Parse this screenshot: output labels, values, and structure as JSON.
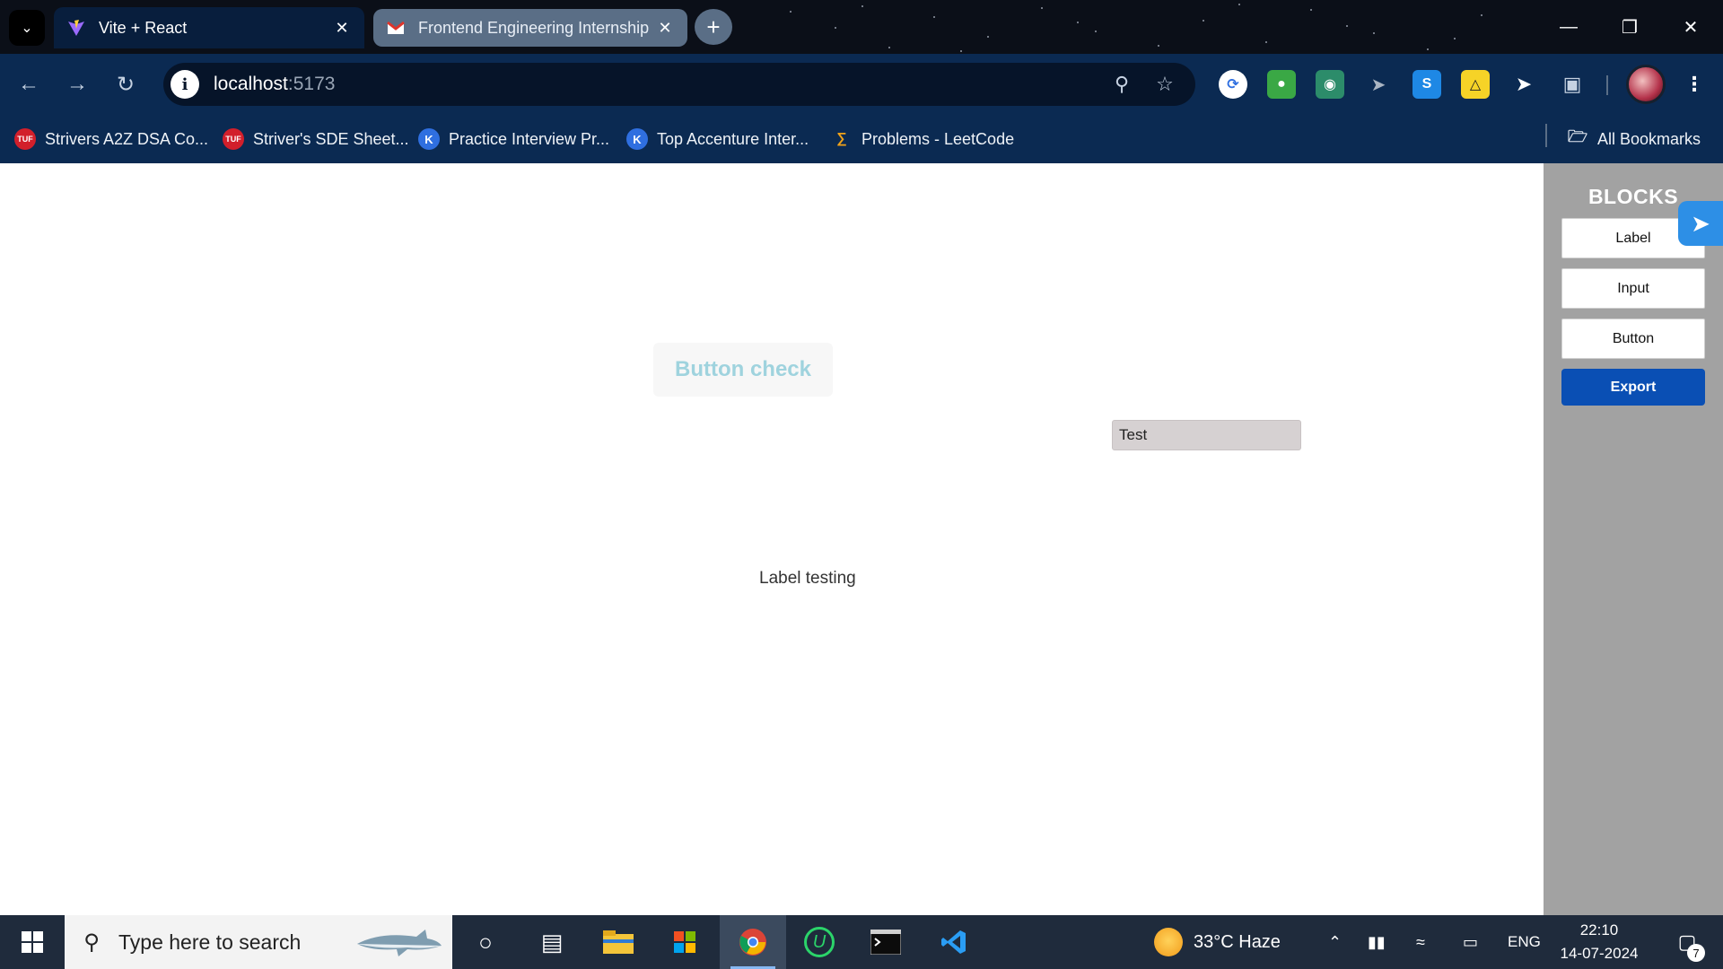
{
  "browser": {
    "tabs": [
      {
        "title": "Vite + React",
        "active": true,
        "favicon": "vite-icon"
      },
      {
        "title": "Frontend Engineering Internship",
        "active": false,
        "favicon": "gmail-icon"
      }
    ],
    "address": {
      "host": "localhost",
      "port": ":5173"
    },
    "bookmarks": [
      {
        "label": "Strivers A2Z DSA Co...",
        "icon": "tuf-icon",
        "color": "#d21f2b"
      },
      {
        "label": "Striver's SDE Sheet...",
        "icon": "tuf-icon",
        "color": "#d21f2b"
      },
      {
        "label": "Practice Interview Pr...",
        "icon": "k-icon",
        "color": "#2f6fe0"
      },
      {
        "label": "Top Accenture Inter...",
        "icon": "k-icon",
        "color": "#2f6fe0"
      },
      {
        "label": "Problems - LeetCode",
        "icon": "leetcode-icon",
        "color": "#f0a21a"
      }
    ],
    "all_bookmarks_label": "All Bookmarks"
  },
  "page": {
    "canvas": {
      "button_label": "Button check",
      "input_value": "Test",
      "label_text": "Label testing"
    },
    "sidebar": {
      "heading": "BLOCKS",
      "blocks": [
        "Label",
        "Input",
        "Button"
      ],
      "export_label": "Export"
    }
  },
  "taskbar": {
    "search_placeholder": "Type here to search",
    "weather": "33°C  Haze",
    "language": "ENG",
    "time": "22:10",
    "date": "14-07-2024",
    "notifications": "7"
  },
  "colors": {
    "toolbar": "#0b2a52",
    "sidebar": "#a2a2a2",
    "export": "#0a4fb4",
    "canvas_button_text": "#9fd3de",
    "input_bg": "#d6d1d2"
  }
}
